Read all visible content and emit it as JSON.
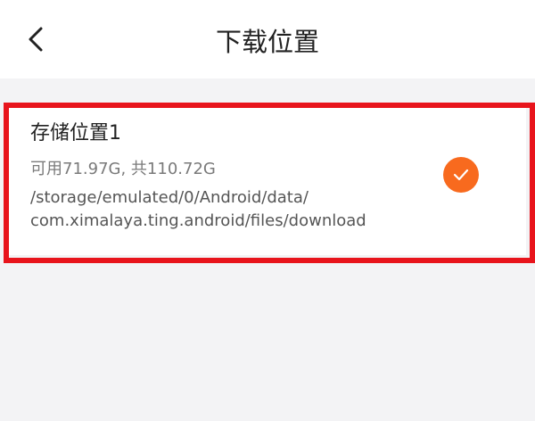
{
  "header": {
    "back_icon": "chevron-left-icon",
    "title": "下载位置"
  },
  "storage": {
    "name": "存储位置1",
    "capacity": "可用71.97G, 共110.72G",
    "path_line1": "/storage/emulated/0/Android/data/",
    "path_line2": "com.ximalaya.ting.android/files/download",
    "selected": true,
    "check_icon": "check-icon"
  },
  "colors": {
    "accent": "#f86a1e",
    "highlight": "#e8141c",
    "background": "#f3f3f5"
  }
}
